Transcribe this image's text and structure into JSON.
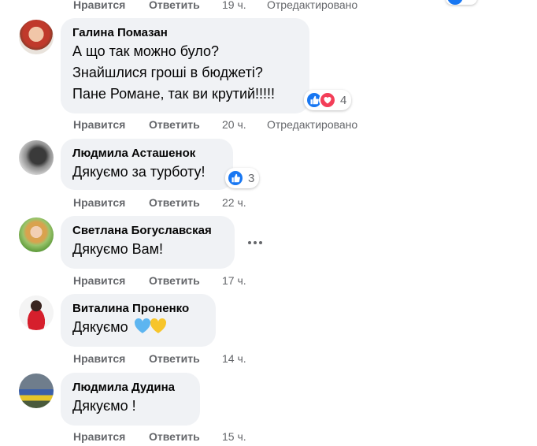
{
  "top_partial": {
    "like": "Нравится",
    "reply": "Ответить",
    "time": "19 ч.",
    "edited": "Отредактировано"
  },
  "comments": [
    {
      "author": "Галина Помазан",
      "lines": [
        "А що так можно було?",
        "Знайшлися гроші в бюджеті?",
        "Пане Романе, так ви крутий!!!!!"
      ],
      "reactions": {
        "icons": [
          "like-icon",
          "love-icon"
        ],
        "count": "4"
      },
      "actions": {
        "like": "Нравится",
        "reply": "Ответить",
        "time": "20 ч.",
        "edited": "Отредактировано"
      }
    },
    {
      "author": "Людмила Асташенок",
      "lines": [
        "Дякуємо за турботу!"
      ],
      "reactions": {
        "icons": [
          "like-icon"
        ],
        "count": "3"
      },
      "actions": {
        "like": "Нравится",
        "reply": "Ответить",
        "time": "22 ч."
      }
    },
    {
      "author": "Светлана Богуславская",
      "lines": [
        "Дякуємо Вам!"
      ],
      "actions": {
        "like": "Нравится",
        "reply": "Ответить",
        "time": "17 ч."
      }
    },
    {
      "author": "Виталина Проненко",
      "lines": [
        "Дякуємо"
      ],
      "emoji": [
        "blue-heart-icon",
        "yellow-heart-icon"
      ],
      "actions": {
        "like": "Нравится",
        "reply": "Ответить",
        "time": "14 ч."
      }
    },
    {
      "author": "Людмила Дудина",
      "lines": [
        "Дякуємо !"
      ],
      "actions": {
        "like": "Нравится",
        "reply": "Ответить",
        "time": "15 ч."
      }
    }
  ],
  "colors": {
    "bubble": "#f0f2f5",
    "secondary_text": "#65676b",
    "like_blue": "#1877f2",
    "love_red": "#f33e58"
  }
}
